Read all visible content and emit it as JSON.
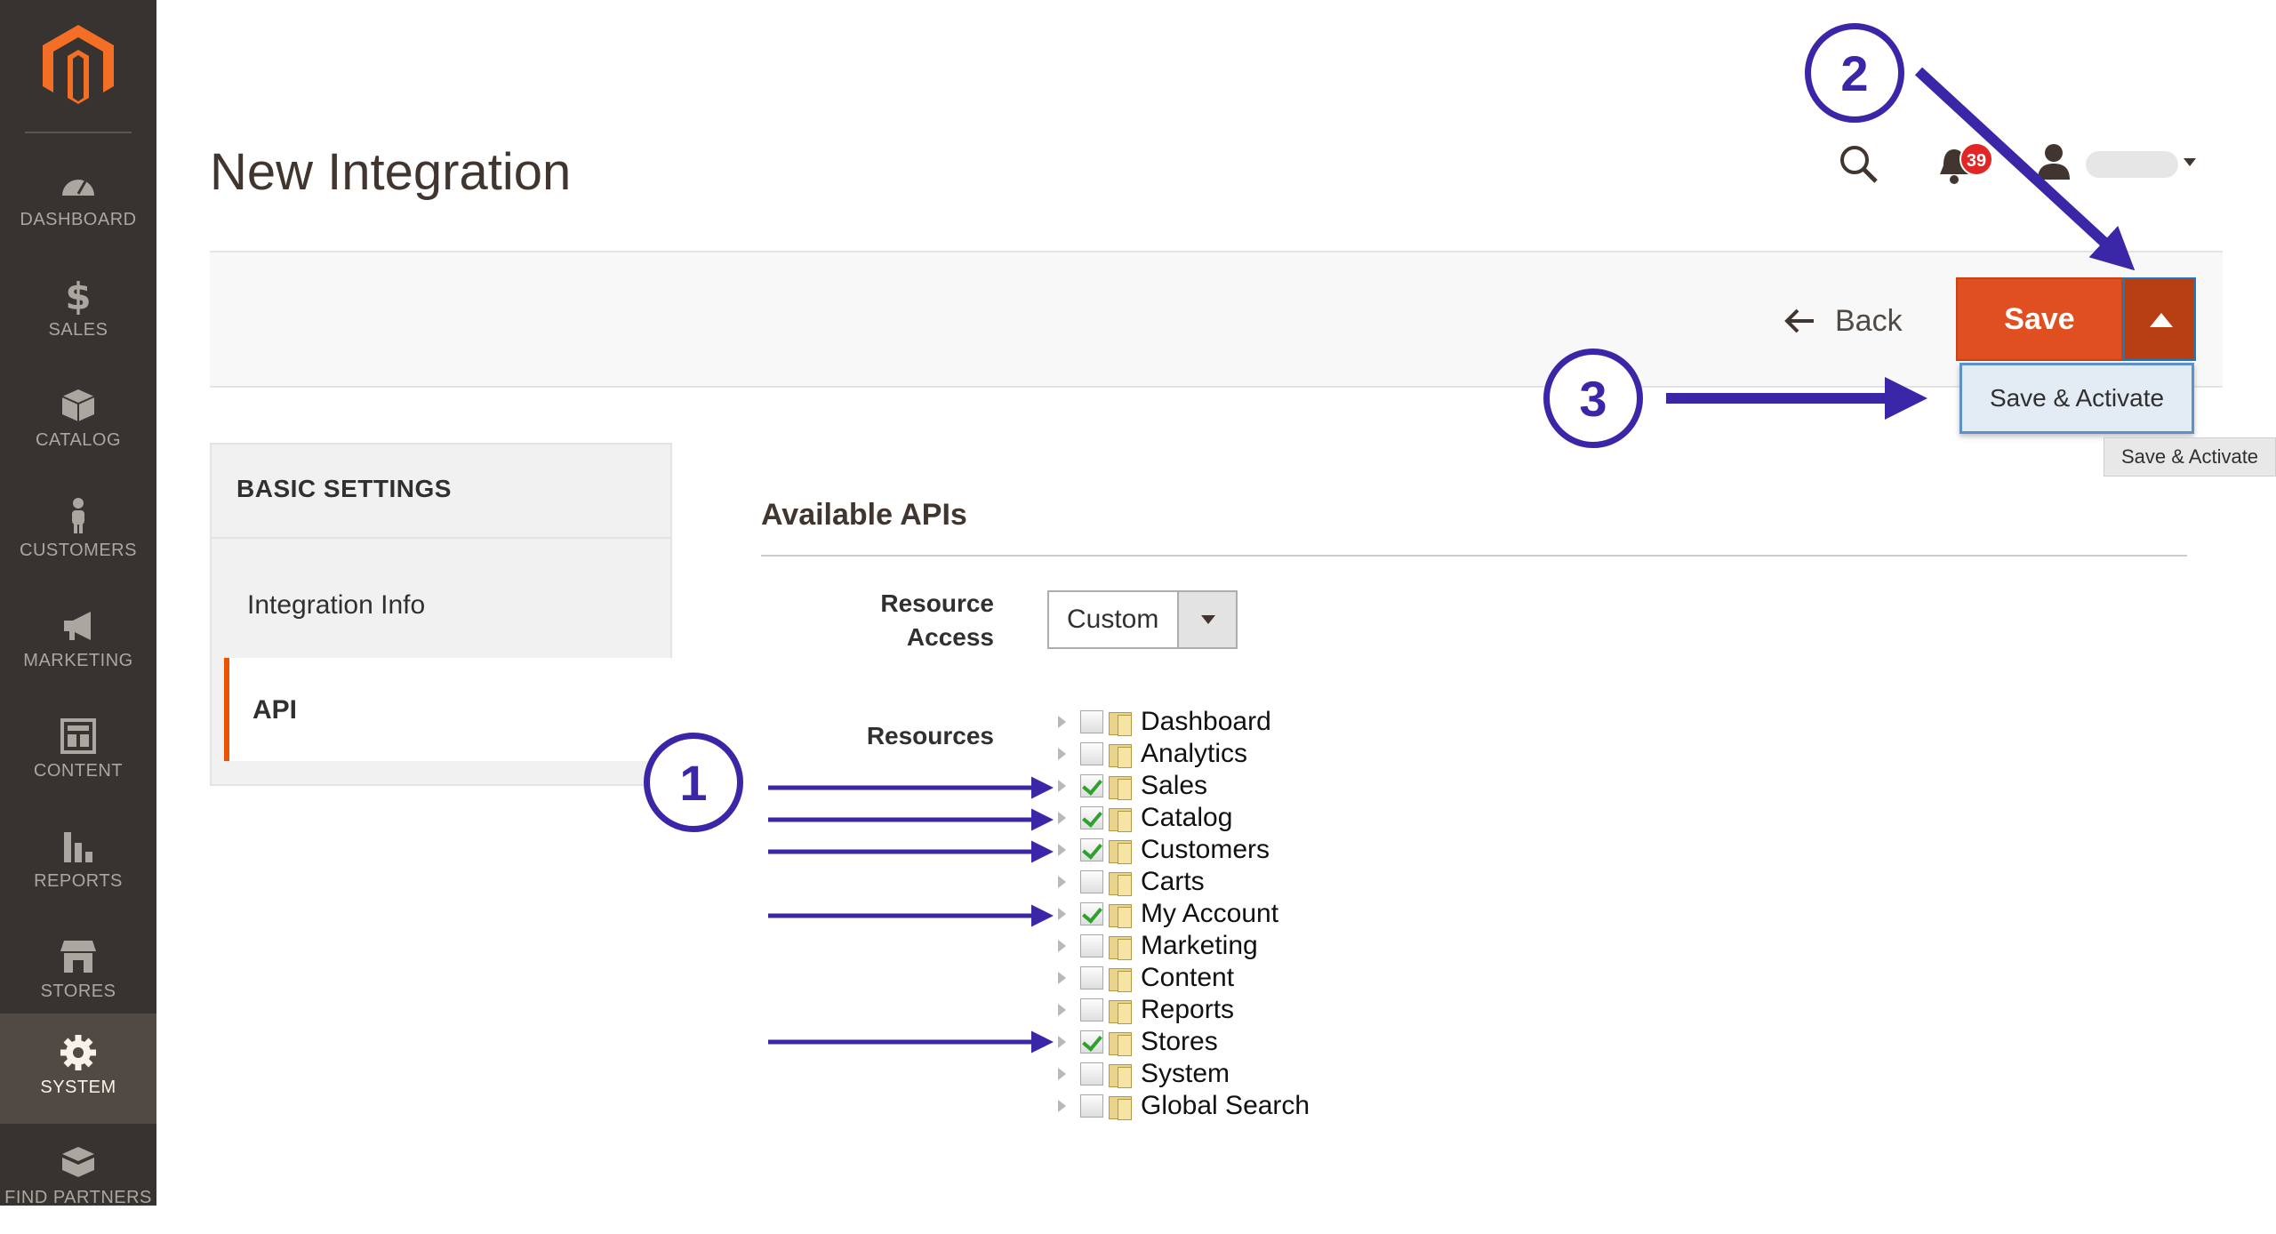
{
  "sidebar": {
    "items": [
      {
        "label": "DASHBOARD",
        "icon": "dashboard-icon"
      },
      {
        "label": "SALES",
        "icon": "dollar-icon"
      },
      {
        "label": "CATALOG",
        "icon": "box-icon"
      },
      {
        "label": "CUSTOMERS",
        "icon": "person-icon"
      },
      {
        "label": "MARKETING",
        "icon": "megaphone-icon"
      },
      {
        "label": "CONTENT",
        "icon": "layout-icon"
      },
      {
        "label": "REPORTS",
        "icon": "bar-chart-icon"
      },
      {
        "label": "STORES",
        "icon": "storefront-icon"
      },
      {
        "label": "SYSTEM",
        "icon": "gear-icon"
      },
      {
        "label": "FIND PARTNERS",
        "icon": "blocks-icon"
      }
    ],
    "active": "SYSTEM"
  },
  "header": {
    "title": "New Integration",
    "notification_count": "39"
  },
  "actions": {
    "back_label": "Back",
    "save_label": "Save",
    "dropdown_item": "Save & Activate",
    "tooltip": "Save & Activate"
  },
  "tabs": {
    "title": "BASIC SETTINGS",
    "items": [
      "Integration Info",
      "API"
    ],
    "active": "API"
  },
  "main": {
    "section_title": "Available APIs",
    "resource_access_label": "Resource Access",
    "resource_access_value": "Custom",
    "resources_label": "Resources",
    "resources": [
      {
        "label": "Dashboard",
        "checked": false
      },
      {
        "label": "Analytics",
        "checked": false
      },
      {
        "label": "Sales",
        "checked": true
      },
      {
        "label": "Catalog",
        "checked": true
      },
      {
        "label": "Customers",
        "checked": true
      },
      {
        "label": "Carts",
        "checked": false
      },
      {
        "label": "My Account",
        "checked": true
      },
      {
        "label": "Marketing",
        "checked": false
      },
      {
        "label": "Content",
        "checked": false
      },
      {
        "label": "Reports",
        "checked": false
      },
      {
        "label": "Stores",
        "checked": true
      },
      {
        "label": "System",
        "checked": false
      },
      {
        "label": "Global Search",
        "checked": false
      }
    ]
  },
  "annotations": {
    "callout_1": "1",
    "callout_2": "2",
    "callout_3": "3",
    "color": "#3a27a8"
  },
  "colors": {
    "sidebar_bg": "#373330",
    "sidebar_active": "#514943",
    "save_orange": "#e04f1f",
    "tab_accent": "#eb5202"
  }
}
